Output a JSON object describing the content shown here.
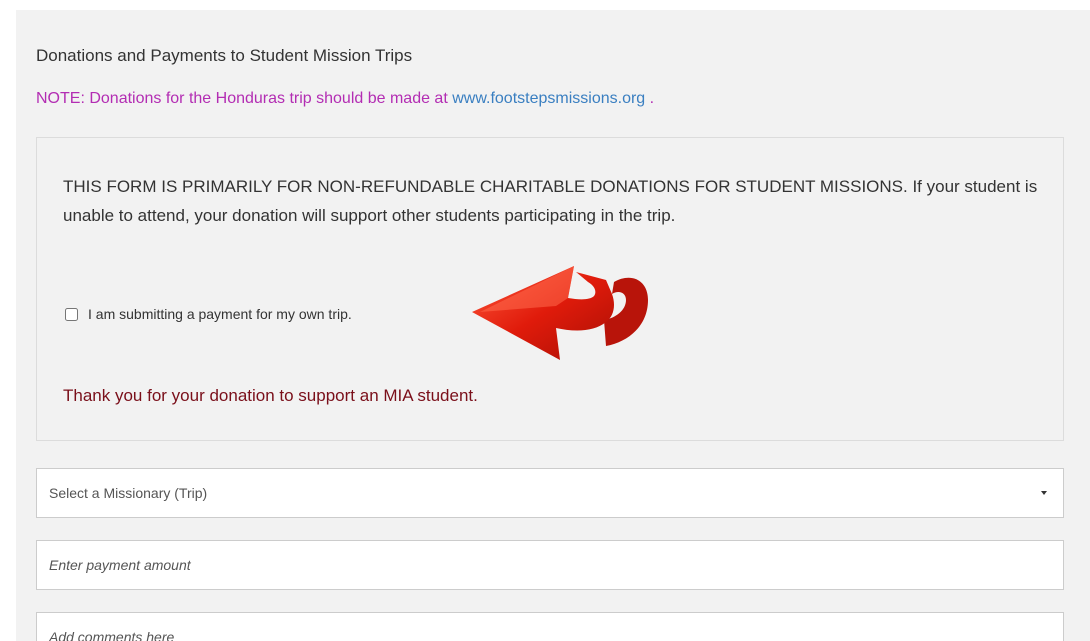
{
  "header": {
    "title": "Donations and Payments to Student Mission Trips",
    "note_prefix": "NOTE: Donations for the Honduras trip should be made at",
    "note_link": "www.footstepsmissions.org",
    "note_suffix": " ."
  },
  "notice": {
    "text": "THIS FORM IS PRIMARILY FOR NON-REFUNDABLE CHARITABLE DONATIONS FOR STUDENT MISSIONS. If your student is unable to attend, your donation will support other students participating in the trip.",
    "checkbox_label": "I am submitting a payment for my own trip.",
    "checkbox_checked": false,
    "thanks": "Thank you for your donation to support an MIA student."
  },
  "form": {
    "missionary_select": "Select a Missionary (Trip)",
    "amount_placeholder": "Enter payment amount",
    "comments_placeholder": "Add comments here"
  },
  "colors": {
    "note": "#b32db3",
    "link": "#3a7fc1",
    "thanks": "#7a0f1a",
    "arrow": "#e01b0b"
  },
  "icons": {
    "arrow": "red-curved-arrow-icon",
    "select_caret": "caret-down-icon"
  }
}
